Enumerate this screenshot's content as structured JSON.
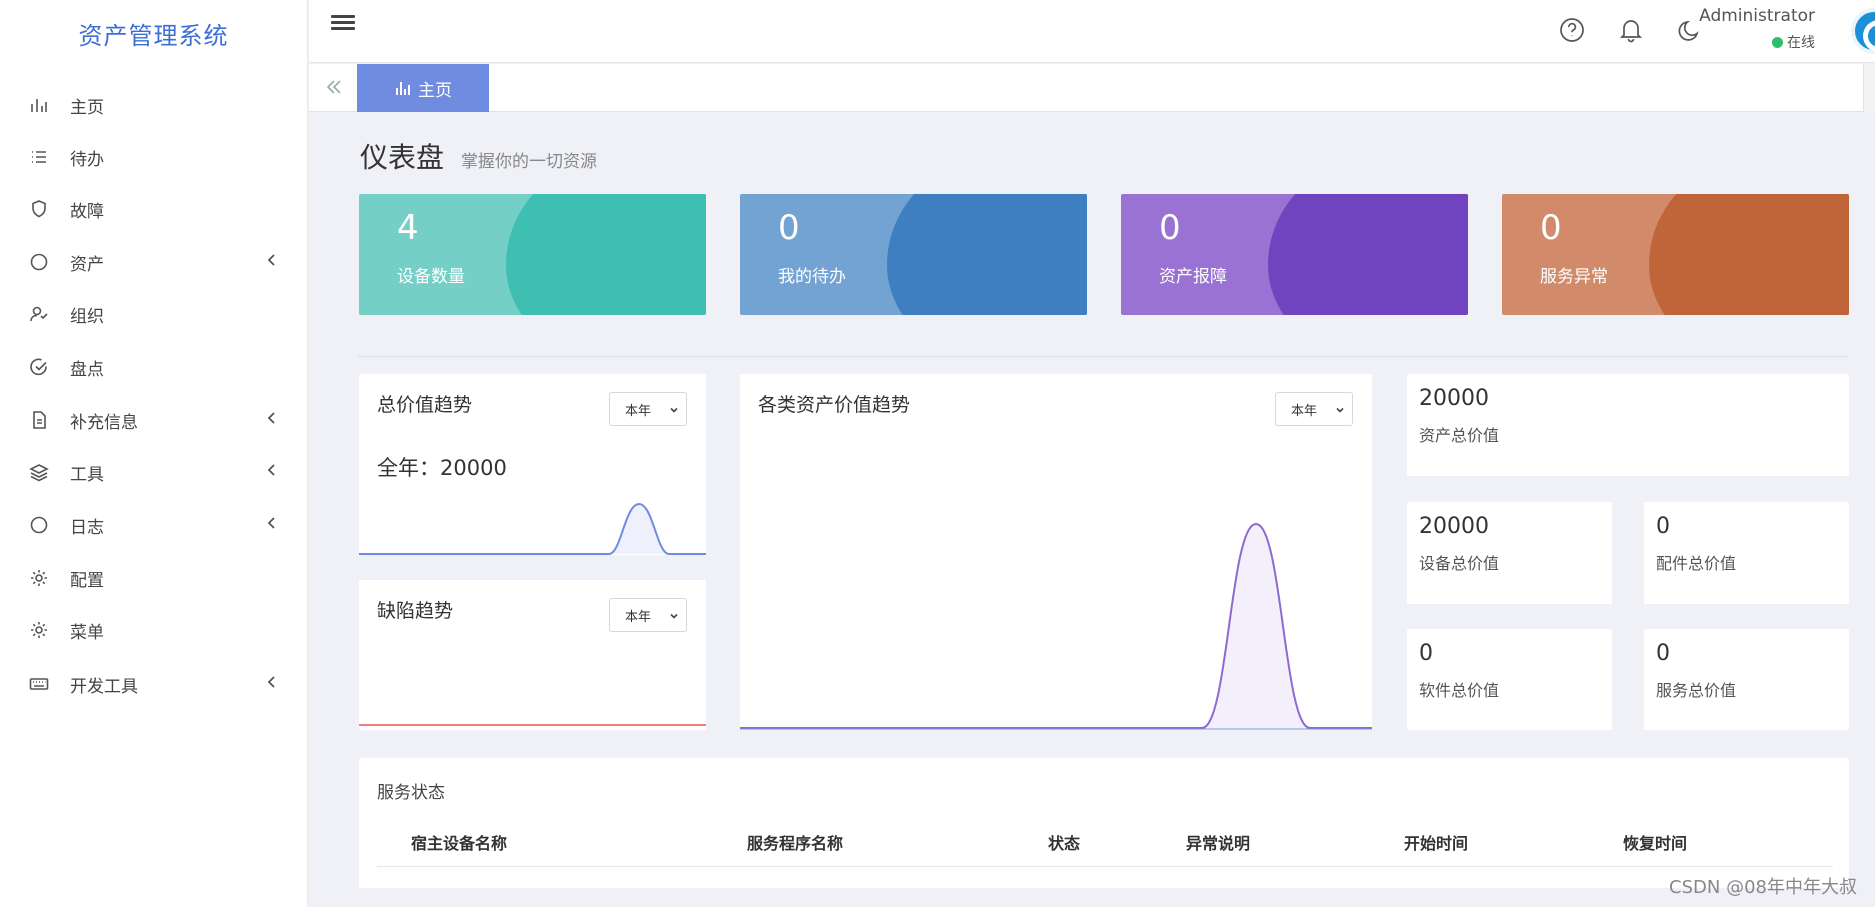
{
  "app": {
    "title": "资产管理系统"
  },
  "sidebar": {
    "items": [
      {
        "label": "主页",
        "icon": "bar-chart-icon",
        "has_submenu": false
      },
      {
        "label": "待办",
        "icon": "list-icon",
        "has_submenu": false
      },
      {
        "label": "故障",
        "icon": "shield-icon",
        "has_submenu": false
      },
      {
        "label": "资产",
        "icon": "circle-icon",
        "has_submenu": true
      },
      {
        "label": "组织",
        "icon": "user-check-icon",
        "has_submenu": false
      },
      {
        "label": "盘点",
        "icon": "check-circle-icon",
        "has_submenu": false
      },
      {
        "label": "补充信息",
        "icon": "document-icon",
        "has_submenu": true
      },
      {
        "label": "工具",
        "icon": "layers-icon",
        "has_submenu": true
      },
      {
        "label": "日志",
        "icon": "circle-icon",
        "has_submenu": true
      },
      {
        "label": "配置",
        "icon": "gear-icon",
        "has_submenu": false
      },
      {
        "label": "菜单",
        "icon": "gear-icon",
        "has_submenu": false
      },
      {
        "label": "开发工具",
        "icon": "keyboard-icon",
        "has_submenu": true
      }
    ]
  },
  "header": {
    "user_name": "Administrator",
    "user_status": "在线",
    "icons": [
      "help-icon",
      "bell-icon",
      "moon-icon"
    ]
  },
  "tabs": {
    "active_label": "主页"
  },
  "page": {
    "title": "仪表盘",
    "subtitle": "掌握你的一切资源"
  },
  "stat_cards": [
    {
      "value": "4",
      "label": "设备数量",
      "color": "#74d0c6",
      "accent": "#3fbfb2"
    },
    {
      "value": "0",
      "label": "我的待办",
      "color": "#72a3d3",
      "accent": "#3d7fc0"
    },
    {
      "value": "0",
      "label": "资产报障",
      "color": "#9a72d4",
      "accent": "#7243bf"
    },
    {
      "value": "0",
      "label": "服务异常",
      "color": "#d18b6b",
      "accent": "#c0653a"
    }
  ],
  "panels": {
    "total_value_trend": {
      "title": "总价值趋势",
      "select": "本年",
      "summary": "全年：20000",
      "line_color": "#6f8ce0"
    },
    "defect_trend": {
      "title": "缺陷趋势",
      "select": "本年",
      "line_color": "#f08080"
    },
    "category_trend": {
      "title": "各类资产价值趋势",
      "select": "本年",
      "line_color": "#8e6bd0"
    }
  },
  "kpis": {
    "asset_total": {
      "value": "20000",
      "label": "资产总价值"
    },
    "device_total": {
      "value": "20000",
      "label": "设备总价值"
    },
    "parts_total": {
      "value": "0",
      "label": "配件总价值"
    },
    "software_total": {
      "value": "0",
      "label": "软件总价值"
    },
    "service_total": {
      "value": "0",
      "label": "服务总价值"
    }
  },
  "service_status": {
    "title": "服务状态",
    "columns": [
      "宿主设备名称",
      "服务程序名称",
      "状态",
      "异常说明",
      "开始时间",
      "恢复时间"
    ]
  },
  "watermark": "CSDN @08年中年大叔"
}
